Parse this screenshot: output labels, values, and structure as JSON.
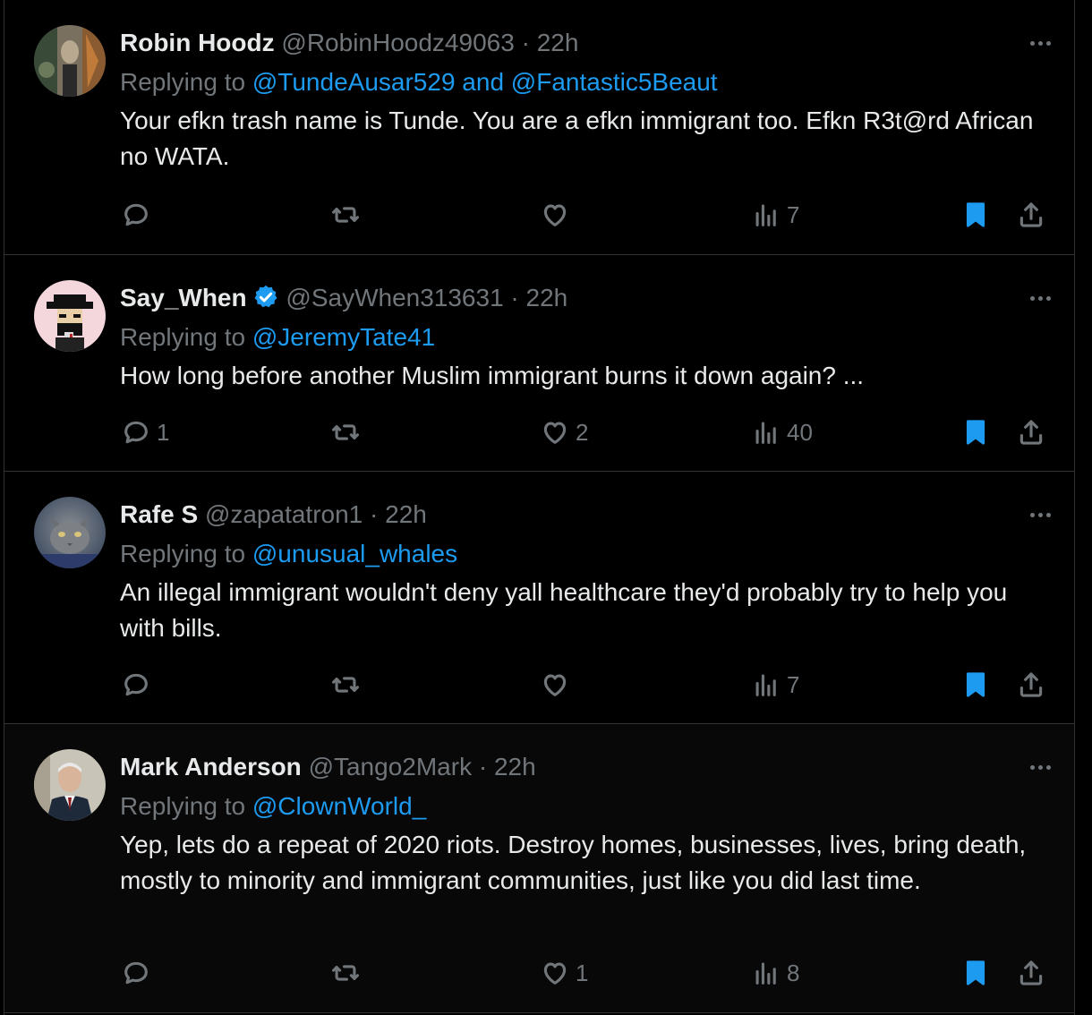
{
  "labels": {
    "replying": "Replying to",
    "and": "and",
    "sep": "·"
  },
  "tweets": [
    {
      "name": "Robin Hoodz",
      "handle": "@RobinHoodz49063",
      "time": "22h",
      "verified": false,
      "mentions": [
        "@TundeAusar529",
        "@Fantastic5Beaut"
      ],
      "text": "Your efkn trash name is Tunde. You are a efkn immigrant too. Efkn R3t@rd African no WATA.",
      "replies": "",
      "retweets": "",
      "likes": "",
      "views": "7",
      "bookmarked": true
    },
    {
      "name": "Say_When",
      "handle": "@SayWhen313631",
      "time": "22h",
      "verified": true,
      "mentions": [
        "@JeremyTate41"
      ],
      "text": "How long before another Muslim immigrant burns it down again? ...",
      "replies": "1",
      "retweets": "",
      "likes": "2",
      "views": "40",
      "bookmarked": true
    },
    {
      "name": "Rafe S",
      "handle": "@zapatatron1",
      "time": "22h",
      "verified": false,
      "mentions": [
        "@unusual_whales"
      ],
      "text": "An illegal immigrant wouldn't deny yall healthcare they'd probably try to help you with bills.",
      "replies": "",
      "retweets": "",
      "likes": "",
      "views": "7",
      "bookmarked": true
    },
    {
      "name": "Mark Anderson",
      "handle": "@Tango2Mark",
      "time": "22h",
      "verified": false,
      "mentions": [
        "@ClownWorld_"
      ],
      "text": "Yep, lets do a repeat of 2020 riots. Destroy homes, businesses, lives, bring death, mostly to minority and immigrant communities, just like you did last time.",
      "replies": "",
      "retweets": "",
      "likes": "1",
      "views": "8",
      "bookmarked": true
    }
  ],
  "colors": {
    "accent": "#1d9bf0",
    "muted": "#71767b",
    "text": "#e7e9ea",
    "border": "#2f3336",
    "background": "#000000"
  },
  "icons": [
    "reply-icon",
    "retweet-icon",
    "like-icon",
    "views-icon",
    "bookmark-icon",
    "share-icon",
    "more-icon",
    "verified-badge-icon"
  ]
}
